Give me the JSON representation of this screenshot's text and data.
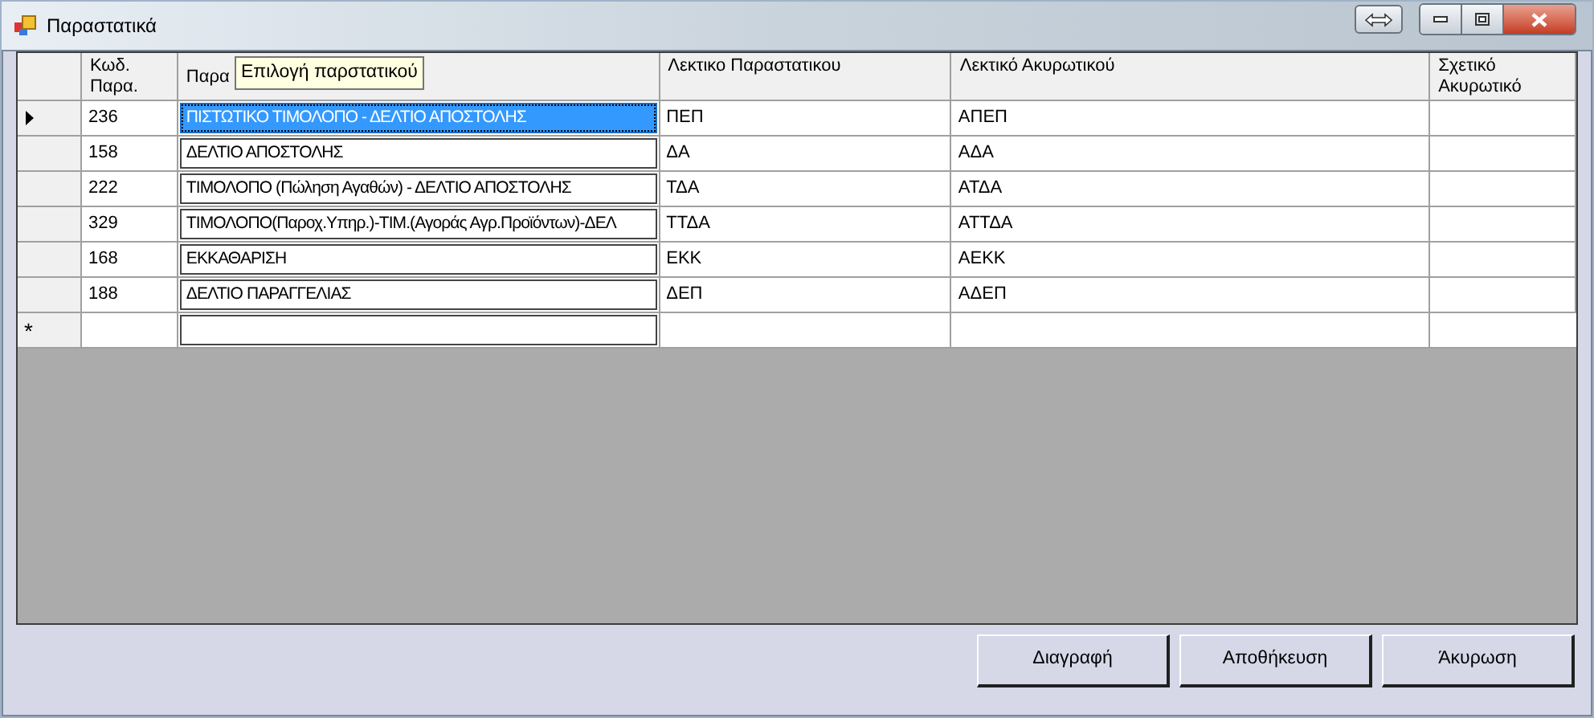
{
  "window": {
    "title": "Παραστατικά"
  },
  "table": {
    "columns": [
      "Κωδ. Παρα.",
      "Παρα",
      "Λεκτικο Παραστατικου",
      "Λεκτικό Ακυρωτικού",
      "Σχετικό Ακυρωτικό"
    ],
    "tooltip": "Επιλογή παρστατικού",
    "rows": [
      {
        "selected": true,
        "cells": [
          "236",
          "ΠΙΣΤΩΤΙΚΟ ΤΙΜΟΛΟΠΟ - ΔΕΛΤΙΟ ΑΠΟΣΤΟΛΗΣ",
          "ΠΕΠ",
          "ΑΠΕΠ"
        ]
      },
      {
        "selected": false,
        "cells": [
          "158",
          "ΔΕΛΤΙΟ ΑΠΟΣΤΟΛΗΣ",
          "ΔΑ",
          "ΑΔΑ"
        ]
      },
      {
        "selected": false,
        "cells": [
          "222",
          "ΤΙΜΟΛΟΠΟ (Πώληση Αγαθών) - ΔΕΛΤΙΟ ΑΠΟΣΤΟΛΗΣ",
          "ΤΔΑ",
          "ΑΤΔΑ"
        ]
      },
      {
        "selected": false,
        "cells": [
          "329",
          "ΤΙΜΟΛΟΠΟ(Παροχ.Υπηρ.)-ΤΙΜ.(Αγοράς Αγρ.Προϊόντων)-ΔΕΛ",
          "ΤΤΔΑ",
          "ΑΤΤΔΑ"
        ]
      },
      {
        "selected": false,
        "cells": [
          "168",
          "ΕΚΚΑΘΑΡΙΣΗ",
          "ΕΚΚ",
          "ΑΕΚΚ"
        ]
      },
      {
        "selected": false,
        "cells": [
          "188",
          "ΔΕΛΤΙΟ ΠΑΡΑΓΓΕΛΙΑΣ",
          "ΔΕΠ",
          "ΑΔΕΠ"
        ]
      }
    ],
    "new_row_marker": "*"
  },
  "buttons": [
    "Διαγραφή",
    "Αποθήκευση",
    "Άκυρωση"
  ]
}
